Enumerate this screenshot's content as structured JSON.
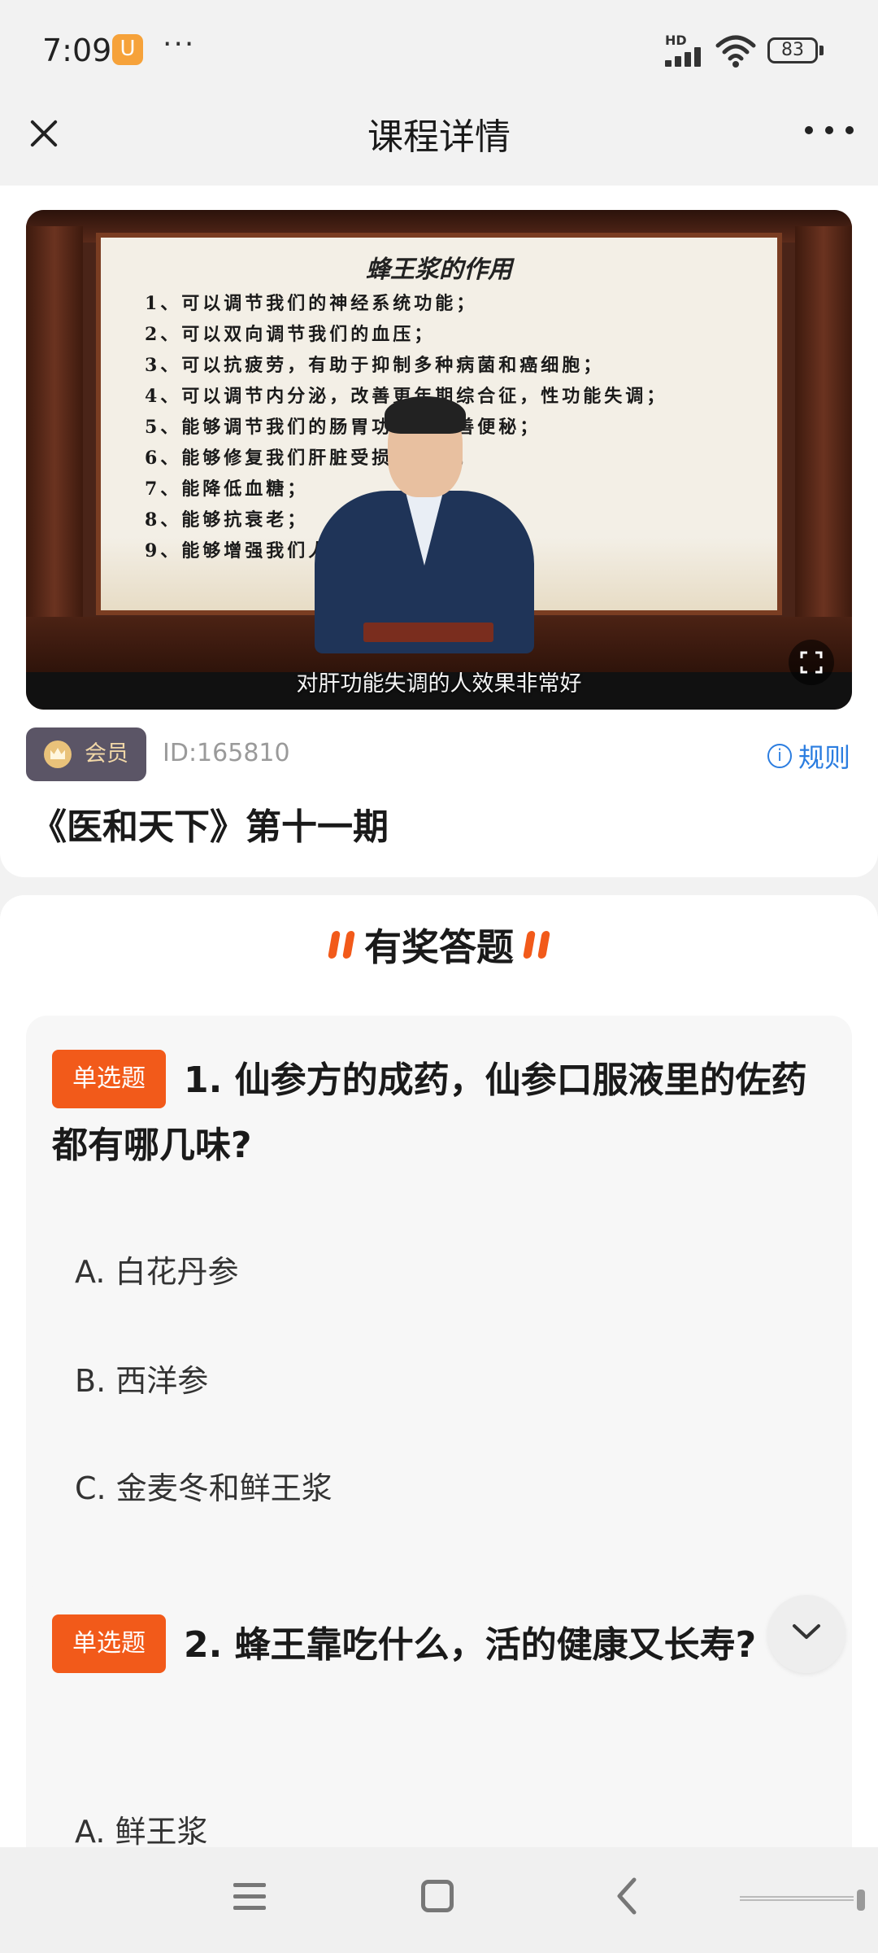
{
  "status_bar": {
    "time": "7:09",
    "app_badge": "U",
    "overflow": "···",
    "network_label": "HD",
    "battery": "83"
  },
  "header": {
    "title": "课程详情"
  },
  "video": {
    "board_title": "蜂王浆的作用",
    "board_lines": [
      "1、可以调节我们的神经系统功能；",
      "2、可以双向调节我们的血压；",
      "3、可以抗疲劳，有助于抑制多种病菌和癌细胞；",
      "4、可以调节内分泌，改善更年期综合征，性功能失调；",
      "5、能够调节我们的肠胃功能，改善便秘；",
      "6、能够修复我们肝脏受损的细胞；",
      "7、能降低血糖；",
      "8、能够抗衰老；",
      "9、能够增强我们人"
    ],
    "subtitle": "对肝功能失调的人效果非常好"
  },
  "course": {
    "member_badge": "会员",
    "id_text": "ID:165810",
    "rules_label": "规则",
    "title": "《医和天下》第十一期"
  },
  "quiz": {
    "title": "有奖答题",
    "questions": [
      {
        "tag": "单选题",
        "text": "1. 仙参方的成药，仙参口服液里的佐药都有哪几味?",
        "options": [
          "A. 白花丹参",
          "B. 西洋参",
          "C. 金麦冬和鲜王浆"
        ]
      },
      {
        "tag": "单选题",
        "text": "2. 蜂王靠吃什么，活的健康又长寿?",
        "options": [
          "A. 鲜王浆"
        ]
      }
    ]
  },
  "colors": {
    "accent": "#f25a1a",
    "link": "#2b7de0",
    "member_bg": "#5b5566",
    "member_text": "#f1d7a7"
  },
  "icons": {
    "close": "close-icon",
    "more": "more-icon",
    "fullscreen": "fullscreen-icon",
    "info": "info-icon",
    "crown": "crown-icon",
    "collapse": "chevron-down-icon"
  }
}
